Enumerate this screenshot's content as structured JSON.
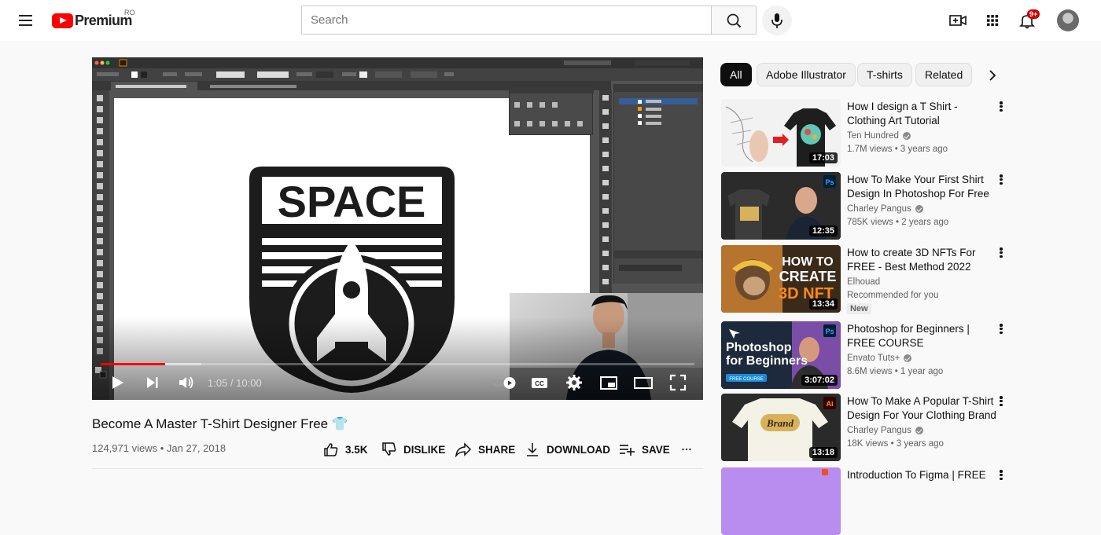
{
  "header": {
    "logo_word": "Premium",
    "country_code": "RO",
    "search_placeholder": "Search",
    "notification_badge": "9+"
  },
  "player": {
    "artwork_text": "SPACE",
    "current_time": "1:05",
    "duration": "10:00",
    "time_display": "1:05 / 10:00",
    "progress_fraction": 0.108,
    "buffered_fraction": 0.17
  },
  "video": {
    "title": "Become A Master T-Shirt Designer Free 👕",
    "meta": "124,971 views • Jan 27, 2018",
    "actions": {
      "like_count": "3.5K",
      "dislike_label": "DISLIKE",
      "share_label": "SHARE",
      "download_label": "DOWNLOAD",
      "save_label": "SAVE"
    }
  },
  "chips": [
    "All",
    "Adobe Illustrator",
    "T-shirts",
    "Related"
  ],
  "recommendations": [
    {
      "title": "How I design a T Shirt - Clothing Art Tutorial",
      "channel": "Ten Hundred",
      "verified": true,
      "views": "1.7M views • 3 years ago",
      "duration": "17:03",
      "colors": [
        "#f2f2f2",
        "#222222"
      ]
    },
    {
      "title": "How To Make Your First Shirt Design In Photoshop For Free",
      "channel": "Charley Pangus",
      "verified": true,
      "views": "785K views • 2 years ago",
      "duration": "12:35",
      "colors": [
        "#2d2d2d",
        "#a68b4b"
      ]
    },
    {
      "title": "How to create 3D NFTs For FREE - Best Method 2022",
      "channel": "Elhouad",
      "verified": false,
      "views": "Recommended for you",
      "badge": "New",
      "duration": "13:34",
      "colors": [
        "#b8722a",
        "#3a2a1a"
      ]
    },
    {
      "title": "Photoshop for Beginners | FREE COURSE",
      "channel": "Envato Tuts+",
      "verified": true,
      "views": "8.6M views • 1 year ago",
      "duration": "3:07:02",
      "colors": [
        "#1b2a3a",
        "#7b4fa8"
      ]
    },
    {
      "title": "How To Make A Popular T-Shirt Design For Your Clothing Brand",
      "channel": "Charley Pangus",
      "verified": true,
      "views": "18K views • 3 years ago",
      "duration": "13:18",
      "colors": [
        "#2a2a2a",
        "#e9e1c7"
      ]
    },
    {
      "title": "Introduction To Figma | FREE",
      "channel": "",
      "verified": false,
      "views": "",
      "duration": "",
      "colors": [
        "#b98cf0",
        "#d9b6ff"
      ]
    }
  ]
}
